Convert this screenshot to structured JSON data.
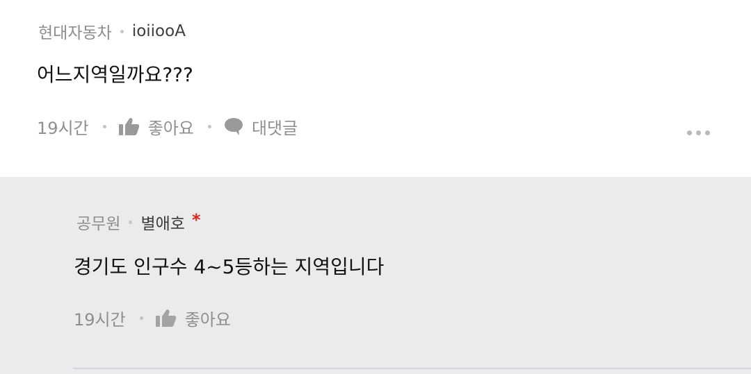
{
  "comment": {
    "company": "현대자동차",
    "nickname": "ioiiooA",
    "text": "어느지역일까요???",
    "time": "19시간",
    "like_label": "좋아요",
    "reply_label": "대댓글",
    "more_icon": "more-horizontal-icon"
  },
  "reply": {
    "company": "공무원",
    "nickname": "별애호",
    "author_badge": "*",
    "text": "경기도 인구수 4~5등하는 지역입니다",
    "time": "19시간",
    "like_label": "좋아요"
  },
  "colors": {
    "reply_background": "#ebebee",
    "author_badge": "#e0211c",
    "meta_text": "#8f8f8f"
  }
}
